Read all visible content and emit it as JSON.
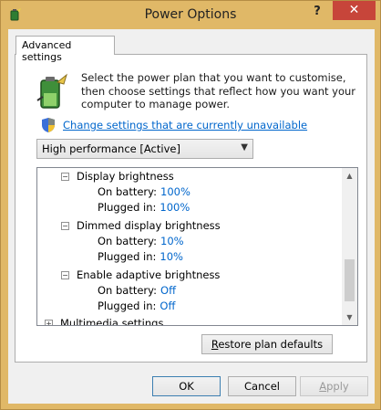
{
  "window": {
    "title": "Power Options",
    "help": "?",
    "close": "✕"
  },
  "tab": {
    "label": "Advanced settings"
  },
  "intro": {
    "text": "Select the power plan that you want to customise, then choose settings that reflect how you want your computer to manage power."
  },
  "change_link": "Change settings that are currently unavailable",
  "plan_select": {
    "value": "High performance [Active]"
  },
  "tree": {
    "rows": [
      {
        "label": "Display brightness",
        "expander": "−"
      },
      {
        "label": "On battery:",
        "value": "100%"
      },
      {
        "label": "Plugged in:",
        "value": "100%"
      },
      {
        "label": "Dimmed display brightness",
        "expander": "−"
      },
      {
        "label": "On battery:",
        "value": "10%"
      },
      {
        "label": "Plugged in:",
        "value": "10%"
      },
      {
        "label": "Enable adaptive brightness",
        "expander": "−"
      },
      {
        "label": "On battery:",
        "value": "Off"
      },
      {
        "label": "Plugged in:",
        "value": "Off"
      },
      {
        "label": "Multimedia settings",
        "expander": "+"
      }
    ]
  },
  "buttons": {
    "restore_prefix": "R",
    "restore_rest": "estore plan defaults",
    "ok": "OK",
    "cancel": "Cancel",
    "apply_prefix": "A",
    "apply_rest": "pply"
  },
  "colors": {
    "frame": "#e0b867",
    "link": "#0066cc",
    "close": "#c7453a"
  }
}
